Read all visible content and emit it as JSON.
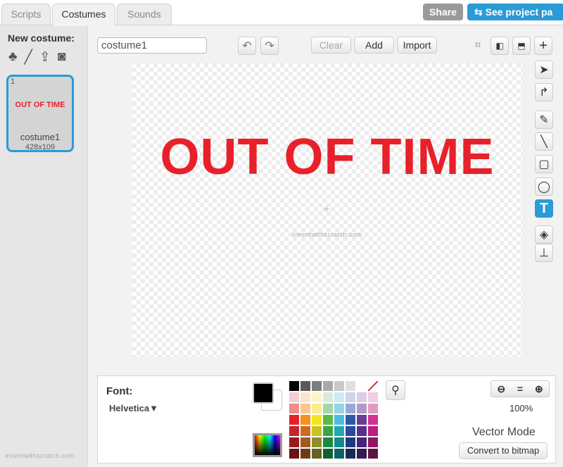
{
  "tabs": [
    {
      "label": "Scripts"
    },
    {
      "label": "Costumes"
    },
    {
      "label": "Sounds"
    }
  ],
  "header": {
    "share": "Share",
    "see_project": "See project pa"
  },
  "left": {
    "new_costume": "New costume:",
    "icons": [
      "sprite-library-icon",
      "paint-brush-icon",
      "upload-icon",
      "camera-icon"
    ],
    "costumes": [
      {
        "index": "1",
        "preview": "OUT OF TIME",
        "name": "costume1",
        "size": "428x109"
      }
    ],
    "watermark": "inventwithscratch.com"
  },
  "editor": {
    "name_value": "costume1",
    "clear": "Clear",
    "add": "Add",
    "import": "Import",
    "canvas_text": "OUT OF TIME",
    "canvas_text_color": "#e8202a",
    "watermark": "inventwithscratch.com"
  },
  "tools": [
    "select-icon",
    "reshape-icon",
    "pencil-icon",
    "line-icon",
    "rectangle-icon",
    "ellipse-icon",
    "text-icon",
    "fill-icon",
    "stamp-icon"
  ],
  "active_tool": "text-icon",
  "bottom": {
    "font_label": "Font:",
    "font_value": "Helvetica",
    "zoom": "100%",
    "mode": "Vector Mode",
    "convert": "Convert to bitmap",
    "primary_color": "#000000",
    "secondary_color": "#ffffff",
    "palette": [
      [
        "#000000",
        "#5a5a5a",
        "#7d7d7d",
        "#a8a8a8",
        "#c8c8c8",
        "#e0e0e0",
        "#ffffff",
        "none"
      ],
      [
        "#f7cdd0",
        "#fde3cc",
        "#fdf6c4",
        "#d6ecd6",
        "#cdeaf3",
        "#cdd5ee",
        "#dccbe5",
        "#f0cde0"
      ],
      [
        "#ef8c8f",
        "#f9c78c",
        "#f8ef8c",
        "#a5d6a5",
        "#95d3e6",
        "#96a9d9",
        "#b498c8",
        "#e09ac0"
      ],
      [
        "#e8202a",
        "#f7901e",
        "#f5e61a",
        "#5cb847",
        "#4cbde0",
        "#2e5aa8",
        "#6a3c96",
        "#d2338e"
      ],
      [
        "#c1272d",
        "#d2691e",
        "#c8c31e",
        "#3aa641",
        "#1eaab4",
        "#274b9c",
        "#5c2f8c",
        "#bc1e82"
      ],
      [
        "#961c1f",
        "#a15a22",
        "#8f8e2a",
        "#1a8a40",
        "#138a8e",
        "#1e3a7e",
        "#4a2378",
        "#8c1960"
      ],
      [
        "#6a1214",
        "#6d3c15",
        "#646324",
        "#11612b",
        "#0d6364",
        "#162a5a",
        "#341955",
        "#5e1243"
      ]
    ]
  }
}
